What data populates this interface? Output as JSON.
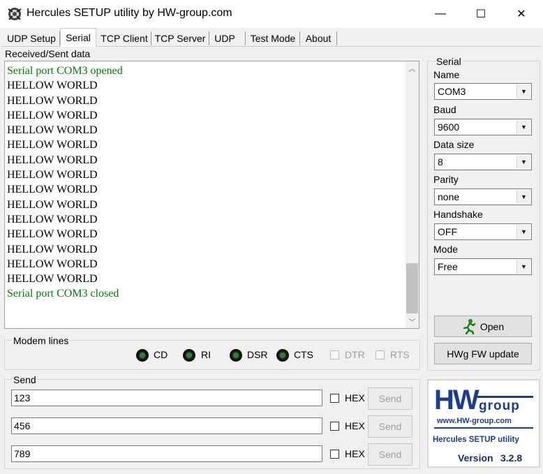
{
  "window": {
    "title": "Hercules SETUP utility by HW-group.com",
    "minimize_glyph": "—",
    "maximize_glyph": "☐",
    "close_glyph": "✕"
  },
  "tabs": [
    {
      "label": "UDP Setup",
      "active": false
    },
    {
      "label": "Serial",
      "active": true
    },
    {
      "label": "TCP Client",
      "active": false
    },
    {
      "label": "TCP Server",
      "active": false
    },
    {
      "label": "UDP",
      "active": false
    },
    {
      "label": "Test Mode",
      "active": false
    },
    {
      "label": "About",
      "active": false
    }
  ],
  "received": {
    "label": "Received/Sent data",
    "lines": [
      {
        "text": "Serial port COM3 opened",
        "kind": "system"
      },
      {
        "text": "HELLOW WORLD",
        "kind": "data"
      },
      {
        "text": "HELLOW WORLD",
        "kind": "data"
      },
      {
        "text": "HELLOW WORLD",
        "kind": "data"
      },
      {
        "text": "HELLOW WORLD",
        "kind": "data"
      },
      {
        "text": "HELLOW WORLD",
        "kind": "data"
      },
      {
        "text": "HELLOW WORLD",
        "kind": "data"
      },
      {
        "text": "HELLOW WORLD",
        "kind": "data"
      },
      {
        "text": "HELLOW WORLD",
        "kind": "data"
      },
      {
        "text": "HELLOW WORLD",
        "kind": "data"
      },
      {
        "text": "HELLOW WORLD",
        "kind": "data"
      },
      {
        "text": "HELLOW WORLD",
        "kind": "data"
      },
      {
        "text": "HELLOW WORLD",
        "kind": "data"
      },
      {
        "text": "HELLOW WORLD",
        "kind": "data"
      },
      {
        "text": "HELLOW WORLD",
        "kind": "data"
      },
      {
        "text": "Serial port COM3 closed",
        "kind": "system"
      }
    ],
    "system_color": "#008000"
  },
  "modem": {
    "title": "Modem lines",
    "leds": [
      "CD",
      "RI",
      "DSR",
      "CTS"
    ],
    "checkboxes": [
      "DTR",
      "RTS"
    ]
  },
  "send": {
    "title": "Send",
    "rows": [
      {
        "value": "123",
        "hex_label": "HEX",
        "button": "Send"
      },
      {
        "value": "456",
        "hex_label": "HEX",
        "button": "Send"
      },
      {
        "value": "789",
        "hex_label": "HEX",
        "button": "Send"
      }
    ]
  },
  "serial": {
    "title": "Serial",
    "fields": [
      {
        "label": "Name",
        "value": "COM3"
      },
      {
        "label": "Baud",
        "value": "9600"
      },
      {
        "label": "Data size",
        "value": "8"
      },
      {
        "label": "Parity",
        "value": "none"
      },
      {
        "label": "Handshake",
        "value": "OFF"
      },
      {
        "label": "Mode",
        "value": "Free"
      }
    ],
    "open_button": "Open",
    "fw_button": "HWg FW update"
  },
  "logo": {
    "hw": "HW",
    "group": "group",
    "url": "www.HW-group.com",
    "product": "Hercules SETUP utility",
    "version_label": "Version",
    "version": "3.2.8",
    "brand_color": "#1b3d8f"
  }
}
